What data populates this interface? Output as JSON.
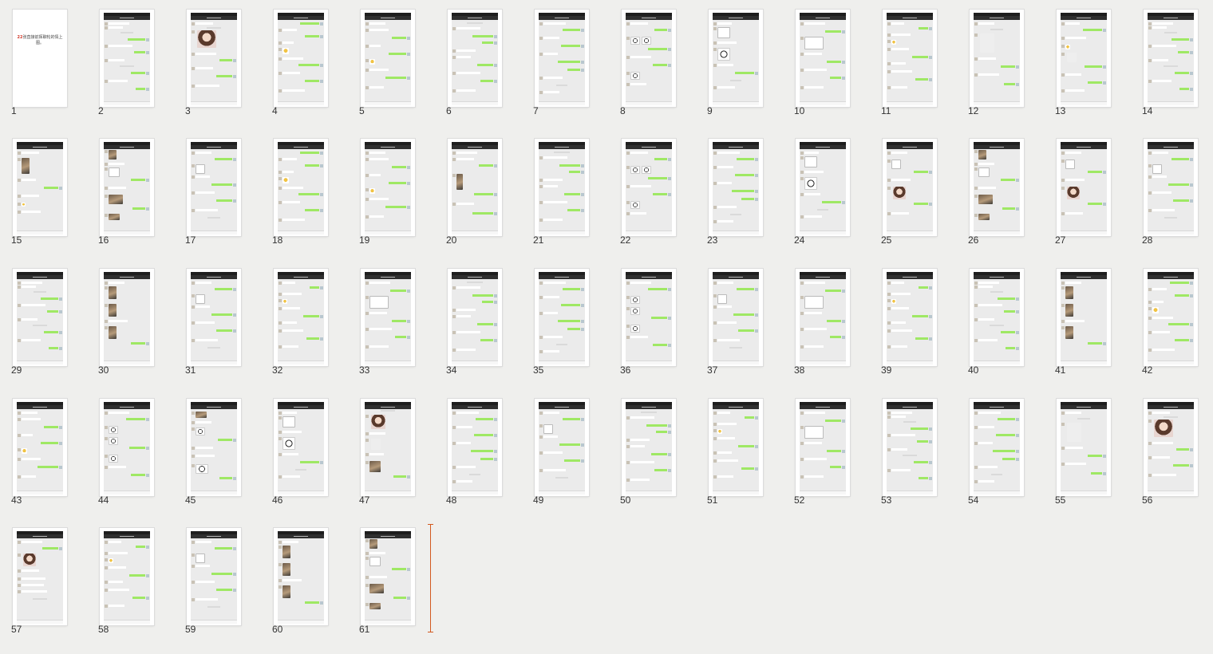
{
  "view": "slide-sorter",
  "title_slide": {
    "number": "1",
    "text_highlight": "22",
    "text_main": "张直接前挥聊轮的情上图。"
  },
  "slides": [
    {
      "n": "2",
      "v": 0
    },
    {
      "n": "3",
      "v": 1
    },
    {
      "n": "4",
      "v": 2
    },
    {
      "n": "5",
      "v": 3
    },
    {
      "n": "6",
      "v": 4
    },
    {
      "n": "7",
      "v": 5
    },
    {
      "n": "8",
      "v": 6
    },
    {
      "n": "9",
      "v": 7
    },
    {
      "n": "10",
      "v": 8
    },
    {
      "n": "11",
      "v": 9
    },
    {
      "n": "12",
      "v": 10
    },
    {
      "n": "13",
      "v": 11
    },
    {
      "n": "14",
      "v": 0
    },
    {
      "n": "15",
      "v": 12
    },
    {
      "n": "16",
      "v": 13
    },
    {
      "n": "17",
      "v": 14
    },
    {
      "n": "18",
      "v": 2
    },
    {
      "n": "19",
      "v": 3
    },
    {
      "n": "20",
      "v": 15
    },
    {
      "n": "21",
      "v": 4
    },
    {
      "n": "22",
      "v": 6
    },
    {
      "n": "23",
      "v": 5
    },
    {
      "n": "24",
      "v": 7
    },
    {
      "n": "25",
      "v": 16
    },
    {
      "n": "26",
      "v": 13
    },
    {
      "n": "27",
      "v": 16
    },
    {
      "n": "28",
      "v": 14
    },
    {
      "n": "29",
      "v": 0
    },
    {
      "n": "30",
      "v": 17
    },
    {
      "n": "31",
      "v": 14
    },
    {
      "n": "32",
      "v": 9
    },
    {
      "n": "33",
      "v": 8
    },
    {
      "n": "34",
      "v": 4
    },
    {
      "n": "35",
      "v": 5
    },
    {
      "n": "36",
      "v": 18
    },
    {
      "n": "37",
      "v": 14
    },
    {
      "n": "38",
      "v": 8
    },
    {
      "n": "39",
      "v": 9
    },
    {
      "n": "40",
      "v": 0
    },
    {
      "n": "41",
      "v": 17
    },
    {
      "n": "42",
      "v": 2
    },
    {
      "n": "43",
      "v": 3
    },
    {
      "n": "44",
      "v": 18
    },
    {
      "n": "45",
      "v": 19
    },
    {
      "n": "46",
      "v": 7
    },
    {
      "n": "47",
      "v": 20
    },
    {
      "n": "48",
      "v": 5
    },
    {
      "n": "49",
      "v": 14
    },
    {
      "n": "50",
      "v": 4
    },
    {
      "n": "51",
      "v": 9
    },
    {
      "n": "52",
      "v": 8
    },
    {
      "n": "53",
      "v": 0
    },
    {
      "n": "54",
      "v": 5
    },
    {
      "n": "55",
      "v": 10
    },
    {
      "n": "56",
      "v": 1
    },
    {
      "n": "57",
      "v": 21
    },
    {
      "n": "58",
      "v": 9
    },
    {
      "n": "59",
      "v": 14
    },
    {
      "n": "60",
      "v": 17
    },
    {
      "n": "61",
      "v": 13
    }
  ]
}
